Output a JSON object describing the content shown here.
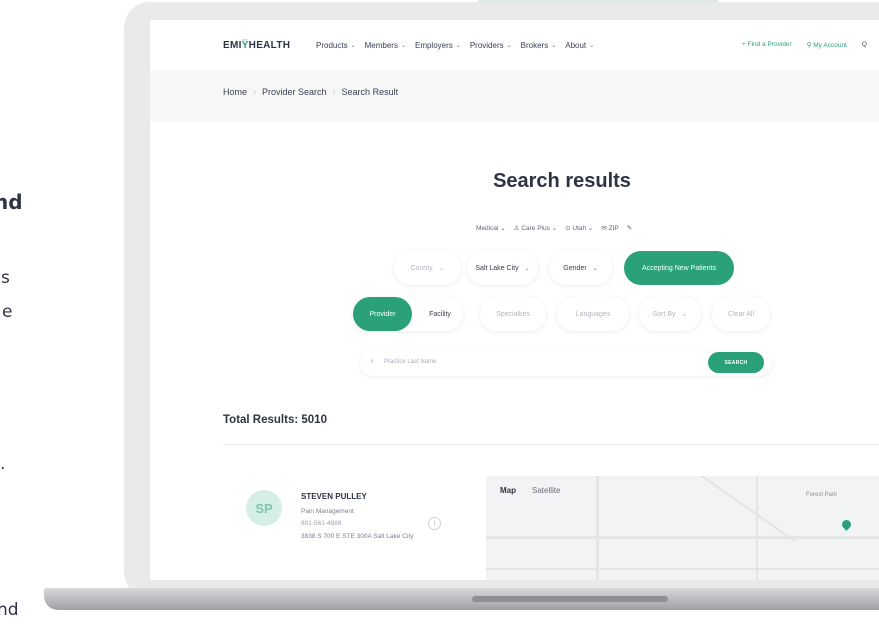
{
  "side": {
    "bold": "nd",
    "line1": "s",
    "line2": "e",
    "line3": ".",
    "line4": "nd"
  },
  "nav": {
    "logo_left": "EMI",
    "logo_right": "HEALTH",
    "menu": [
      "Products",
      "Members",
      "Employers",
      "Providers",
      "Brokers",
      "About"
    ],
    "find_provider": "+ Find a Provider",
    "my_account": "My Account",
    "search_glyph": "Q"
  },
  "breadcrumb": [
    "Home",
    "Provider Search",
    "Search Result"
  ],
  "page_title": "Search results",
  "filter_summary": {
    "plan_type": "Medical",
    "network": "Care Plus",
    "state": "Utah",
    "zip": "ZIP"
  },
  "filters": {
    "county": "County",
    "city": "Salt Lake City",
    "gender": "Gender",
    "accepting": "Accepting New Patients",
    "provider_tab": "Provider",
    "facility_tab": "Facility",
    "specialties": "Specialties",
    "languages": "Languages",
    "sort_by": "Sort By",
    "clear_all": "Clear All"
  },
  "search": {
    "placeholder": "Practice Last Name",
    "button": "SEARCH"
  },
  "total_results": "Total Results: 5010",
  "result": {
    "initials": "SP",
    "name": "STEVEN PULLEY",
    "specialty": "Pain Management",
    "phone": "801-561-4988",
    "address": "3838 S 700 E STE 300A Salt Lake City"
  },
  "map": {
    "tab_map": "Map",
    "tab_satellite": "Satellite",
    "place": "Forest Park"
  },
  "colors": {
    "accent": "#2ba17a",
    "text": "#2f3445"
  }
}
